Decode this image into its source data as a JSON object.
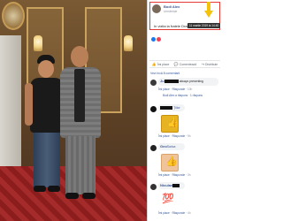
{
  "post": {
    "author": "Bodi Alex",
    "subtitle": "Urmărește",
    "text": "In vizita la fratele Dragu",
    "timestamp": "11 martie 2019 la 14:40"
  },
  "stats": {
    "comments_line": "Vezi încă 8 comentarii"
  },
  "actions": {
    "like": "Îmi place",
    "comment": "Comentează",
    "share": "Distribuie"
  },
  "comments": [
    {
      "name": "Ju",
      "text": "always presenting",
      "like": "Îmi place",
      "reply": "Răspunde",
      "time": "10h",
      "nested": "Bodi Alex a răspuns · 1 răspuns"
    },
    {
      "name": "",
      "text": "Ţiitor",
      "like": "Îmi place",
      "reply": "Răspunde",
      "time": "9h"
    },
    {
      "name": "Geo",
      "text": "Sarica",
      "like": "Îmi place",
      "reply": "Răspunde",
      "time": "3h"
    },
    {
      "name": "Niculae",
      "text": "",
      "like": "Îmi place",
      "reply": "Răspunde",
      "time": "4h"
    }
  ],
  "colors": {
    "fb_blue": "#385898",
    "highlight_red": "#e53935",
    "arrow_yellow": "#f4c20d",
    "like_blue": "#1877f2",
    "love_red": "#f33e58"
  },
  "icons": [
    "like-icon",
    "love-icon",
    "comment-icon",
    "share-icon",
    "down-arrow-icon",
    "thumbs-up-sticker-icon",
    "thumbs-up-sticker-icon",
    "hundred-sticker-icon"
  ]
}
